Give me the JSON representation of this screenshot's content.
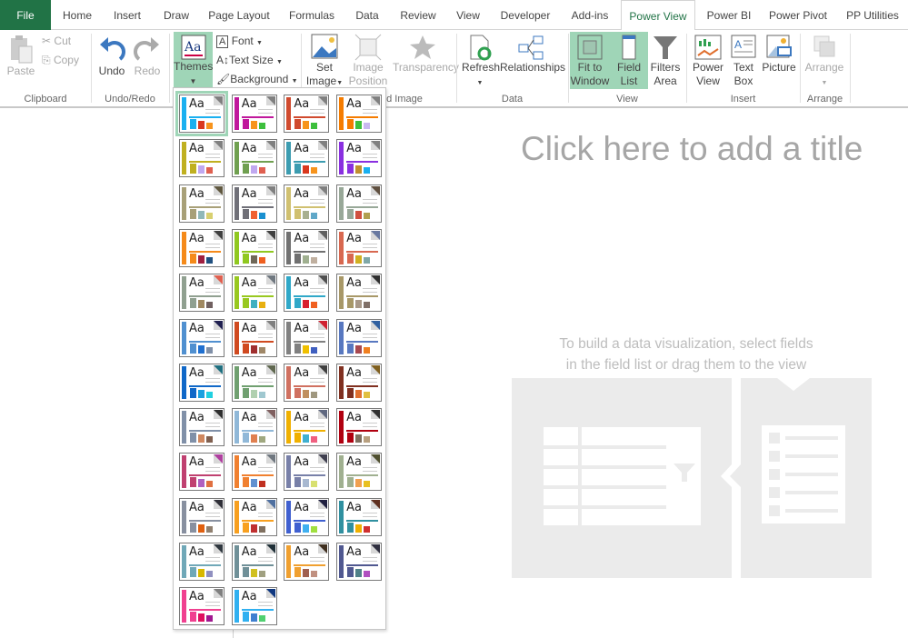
{
  "tabs": [
    "File",
    "Home",
    "Insert",
    "Draw",
    "Page Layout",
    "Formulas",
    "Data",
    "Review",
    "View",
    "Developer",
    "Add-ins",
    "Power View",
    "Power BI",
    "Power Pivot",
    "PP Utilities"
  ],
  "active_tab": "Power View",
  "ribbon": {
    "clipboard": {
      "paste": "Paste",
      "cut": "Cut",
      "copy": "Copy",
      "label": "Clipboard"
    },
    "undo": {
      "undo": "Undo",
      "redo": "Redo",
      "label": "Undo/Redo"
    },
    "themes": {
      "themes": "Themes",
      "font": "Font",
      "text_size": "Text Size",
      "background": "Background",
      "set_image_1": "Set",
      "set_image_2": "Image",
      "image_position_1": "Image",
      "image_position_2": "Position",
      "transparency": "Transparency",
      "label_partial": "d Image"
    },
    "data": {
      "refresh": "Refresh",
      "relationships": "Relationships",
      "label": "Data"
    },
    "view": {
      "fit1": "Fit to",
      "fit2": "Window",
      "field1": "Field",
      "field2": "List",
      "filters1": "Filters",
      "filters2": "Area",
      "label": "View"
    },
    "insert": {
      "pv1": "Power",
      "pv2": "View",
      "tb1": "Text",
      "tb2": "Box",
      "picture": "Picture",
      "label": "Insert"
    },
    "arrange": {
      "arrange": "Arrange",
      "label": "Arrange"
    }
  },
  "canvas": {
    "title_placeholder": "Click here to add a title",
    "hint_line1": "To build a data visualization, select fields",
    "hint_line2": "in the field list or drag them to the view"
  },
  "themes_gallery": {
    "selected_index": 0,
    "sample_text": "Aa",
    "themes": [
      [
        "#1ab0f0",
        "#1ab0f0",
        "#d9381e",
        "#f7941d",
        "#808080"
      ],
      [
        "#c0189c",
        "#c0189c",
        "#f7941d",
        "#3dbf3d",
        "#808080"
      ],
      [
        "#d04a2e",
        "#d04a2e",
        "#f7941d",
        "#3dbf3d",
        "#808080"
      ],
      [
        "#f57c00",
        "#f57c00",
        "#3dbf3d",
        "#c9b8f0",
        "#808080"
      ],
      [
        "#c0b020",
        "#c0b020",
        "#c0a8f0",
        "#e06050",
        "#808080"
      ],
      [
        "#70a050",
        "#70a050",
        "#c0a8f0",
        "#e06050",
        "#808080"
      ],
      [
        "#3c9cb0",
        "#3c9cb0",
        "#d9381e",
        "#f7941d",
        "#808080"
      ],
      [
        "#8a30e0",
        "#8a30e0",
        "#c09030",
        "#1ab0f0",
        "#808080"
      ],
      [
        "#a8a078",
        "#a8a078",
        "#90b8b8",
        "#d8d070",
        "#605840"
      ],
      [
        "#707078",
        "#707078",
        "#f06030",
        "#1a90d0",
        "#808080"
      ],
      [
        "#d0c070",
        "#d0c070",
        "#a8b090",
        "#60a8c8",
        "#808080"
      ],
      [
        "#98a898",
        "#98a898",
        "#d05040",
        "#b0a050",
        "#605040"
      ],
      [
        "#f58a1a",
        "#f58a1a",
        "#a02040",
        "#205080",
        "#404040"
      ],
      [
        "#90c820",
        "#90c820",
        "#706858",
        "#f06020",
        "#404040"
      ],
      [
        "#707070",
        "#707070",
        "#a0b090",
        "#c0b0a0",
        "#606060"
      ],
      [
        "#d86850",
        "#d86850",
        "#d0b020",
        "#80a8a8",
        "#6878a0"
      ],
      [
        "#90a090",
        "#90a090",
        "#a08860",
        "#706060",
        "#e06050"
      ],
      [
        "#98c820",
        "#98c820",
        "#40b0c0",
        "#e8b010",
        "#707880"
      ],
      [
        "#30a8c8",
        "#30a8c8",
        "#d82030",
        "#f06020",
        "#505050"
      ],
      [
        "#a89868",
        "#a89868",
        "#a89888",
        "#807068",
        "#303030"
      ],
      [
        "#5090d0",
        "#5090d0",
        "#2070d0",
        "#8090a8",
        "#202050"
      ],
      [
        "#d04a20",
        "#d04a20",
        "#a03030",
        "#a08868",
        "#808080"
      ],
      [
        "#808080",
        "#808080",
        "#f0c000",
        "#4060c0",
        "#d02030"
      ],
      [
        "#5878c0",
        "#5878c0",
        "#a84850",
        "#f08020",
        "#3060a0"
      ],
      [
        "#1068c8",
        "#1068c8",
        "#1aa0e0",
        "#20d0e0",
        "#207080"
      ],
      [
        "#70a070",
        "#70a070",
        "#b0d0b0",
        "#a0c8d0",
        "#606850"
      ],
      [
        "#d07060",
        "#d07060",
        "#c09060",
        "#a09880",
        "#404040"
      ],
      [
        "#803020",
        "#803020",
        "#e07030",
        "#e0c040",
        "#806020"
      ],
      [
        "#8090a8",
        "#8090a8",
        "#d08860",
        "#806050",
        "#303030"
      ],
      [
        "#90b8d8",
        "#90b8d8",
        "#e08050",
        "#a0a880",
        "#806060"
      ],
      [
        "#f0b000",
        "#f0b000",
        "#40b0d0",
        "#f06080",
        "#606880"
      ],
      [
        "#b00010",
        "#b00010",
        "#807060",
        "#b8a080",
        "#303030"
      ],
      [
        "#c04070",
        "#c04070",
        "#b060c0",
        "#e07040",
        "#b040a0"
      ],
      [
        "#f08030",
        "#f08030",
        "#6090d0",
        "#c03020",
        "#707880"
      ],
      [
        "#7880a8",
        "#7880a8",
        "#a8b8d0",
        "#d8e070",
        "#404050"
      ],
      [
        "#a0b090",
        "#a0b090",
        "#f0a050",
        "#e8c020",
        "#505030"
      ],
      [
        "#8890a0",
        "#8890a0",
        "#e06010",
        "#908070",
        "#303038"
      ],
      [
        "#f8a020",
        "#f8a020",
        "#c03030",
        "#807060",
        "#5070a0"
      ],
      [
        "#4060d0",
        "#4060d0",
        "#40b0f0",
        "#a0e040",
        "#202040"
      ],
      [
        "#3090a0",
        "#3090a0",
        "#f0b000",
        "#d03030",
        "#603020"
      ],
      [
        "#70a8b8",
        "#70a8b8",
        "#d8b800",
        "#9090c0",
        "#303840"
      ],
      [
        "#709098",
        "#709098",
        "#d0c020",
        "#a0a080",
        "#203038"
      ],
      [
        "#f0a030",
        "#f0a030",
        "#a06050",
        "#c09080",
        "#403020"
      ],
      [
        "#505890",
        "#505890",
        "#508088",
        "#b050c0",
        "#303040"
      ],
      [
        "#f04090",
        "#f04090",
        "#e01060",
        "#a01890",
        "#808080"
      ],
      [
        "#30b0f0",
        "#30b0f0",
        "#4080d0",
        "#50d070",
        "#103880"
      ]
    ]
  }
}
